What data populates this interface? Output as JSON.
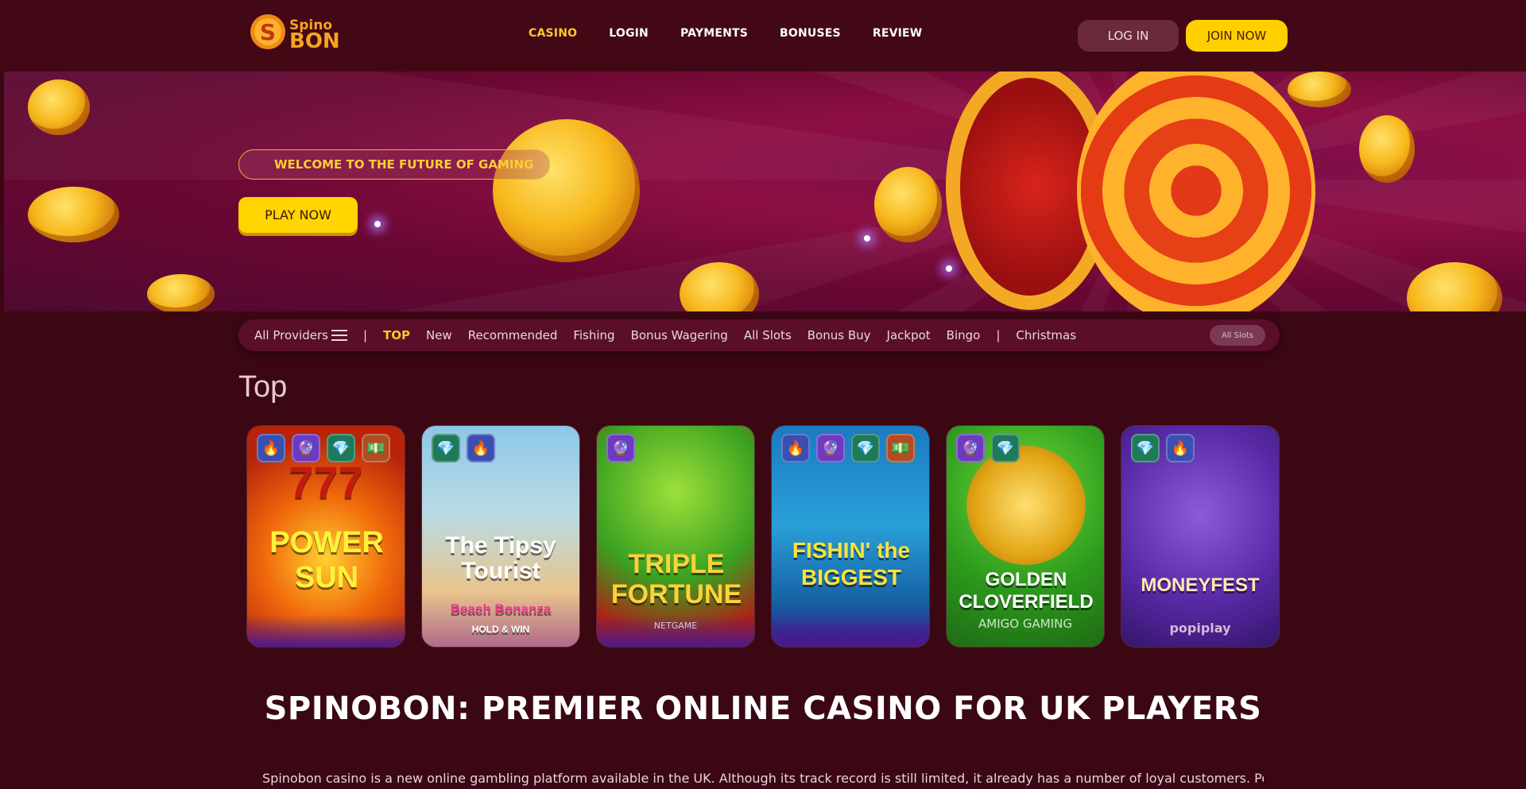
{
  "header": {
    "logo": {
      "line1": "Spino",
      "line2": "BON"
    },
    "nav": [
      "CASINO",
      "LOGIN",
      "PAYMENTS",
      "BONUSES",
      "REVIEW"
    ],
    "login_label": "LOG IN",
    "join_label": "JOIN NOW"
  },
  "hero": {
    "welcome": "WELCOME TO THE FUTURE OF GAMING",
    "play_label": "PLAY NOW"
  },
  "filters": {
    "providers_label": "All Providers",
    "separator": "|",
    "items": [
      "TOP",
      "New",
      "Recommended",
      "Fishing",
      "Bonus Wagering",
      "All Slots",
      "Bonus Buy",
      "Jackpot",
      "Bingo"
    ],
    "extra": "Christmas",
    "pill": "All Slots"
  },
  "section_title": "Top",
  "games": [
    {
      "title": "POWER SUN",
      "top": "777",
      "provider": ""
    },
    {
      "title": "The Tipsy Tourist",
      "sub": "Beach Bonanza",
      "tag": "HOLD & WIN",
      "provider": ""
    },
    {
      "title": "TRIPLE FORTUNE",
      "provider": "NETGAME"
    },
    {
      "title": "FISHIN' the BIGGEST",
      "provider": ""
    },
    {
      "title": "GOLDEN CLOVERFIELD",
      "provider": "AMIGO GAMING"
    },
    {
      "title": "MONEYFEST",
      "provider": "popiplay"
    }
  ],
  "colors": {
    "accent": "#fbc72b",
    "background": "#3a0713",
    "header": "#430816"
  },
  "article": {
    "heading": "SPINOBON: PREMIER ONLINE CASINO FOR UK PLAYERS",
    "intro": "Spinobon casino is a new online gambling platform available in the UK. Although its track record is still limited, it already has a number of loyal customers. People value it for its"
  }
}
